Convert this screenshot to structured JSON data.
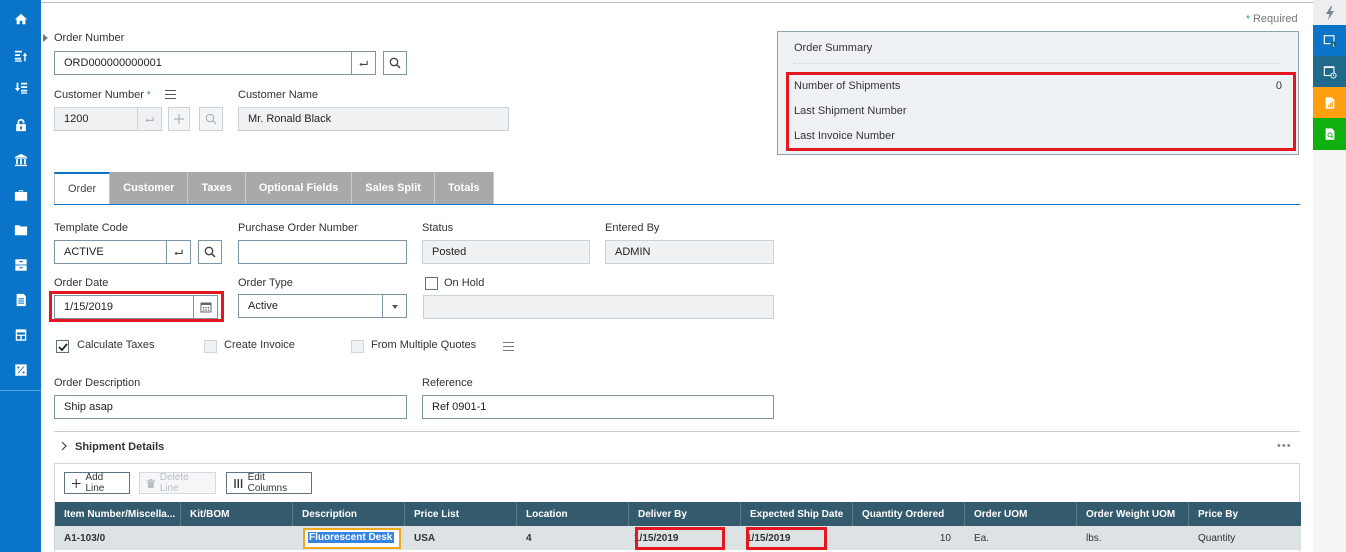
{
  "left_nav": {
    "items": [
      {
        "name": "home-icon"
      },
      {
        "name": "sort-ascending-icon"
      },
      {
        "name": "sort-descending-icon"
      },
      {
        "name": "lock-icon"
      },
      {
        "name": "bank-icon"
      },
      {
        "name": "briefcase-icon"
      },
      {
        "name": "folder-icon"
      },
      {
        "name": "cabinet-icon"
      },
      {
        "name": "document-icon"
      },
      {
        "name": "table-icon"
      },
      {
        "name": "percent-icon"
      }
    ]
  },
  "header": {
    "required_note": "Required",
    "required_mark": "*"
  },
  "order_number": {
    "label": "Order Number",
    "value": "ORD000000000001"
  },
  "customer_number": {
    "label": "Customer Number",
    "required_mark": "*",
    "value": "1200"
  },
  "customer_name": {
    "label": "Customer Name",
    "value": "Mr. Ronald Black"
  },
  "order_summary": {
    "title": "Order Summary",
    "rows": [
      {
        "label": "Number of Shipments",
        "value": "0"
      },
      {
        "label": "Last Shipment Number",
        "value": ""
      },
      {
        "label": "Last Invoice Number",
        "value": ""
      }
    ]
  },
  "tabs": [
    {
      "label": "Order",
      "active": true
    },
    {
      "label": "Customer",
      "active": false
    },
    {
      "label": "Taxes",
      "active": false
    },
    {
      "label": "Optional Fields",
      "active": false
    },
    {
      "label": "Sales Split",
      "active": false
    },
    {
      "label": "Totals",
      "active": false
    }
  ],
  "form": {
    "template_code": {
      "label": "Template Code",
      "value": "ACTIVE"
    },
    "purchase_order_number": {
      "label": "Purchase Order Number",
      "value": ""
    },
    "status": {
      "label": "Status",
      "value": "Posted"
    },
    "entered_by": {
      "label": "Entered By",
      "value": "ADMIN"
    },
    "order_date": {
      "label": "Order Date",
      "value": "1/15/2019"
    },
    "order_type": {
      "label": "Order Type",
      "value": "Active"
    },
    "on_hold": {
      "label": "On Hold",
      "checked": false,
      "value": ""
    },
    "calculate_taxes": {
      "label": "Calculate Taxes",
      "checked": true
    },
    "create_invoice": {
      "label": "Create Invoice",
      "checked": false
    },
    "from_multiple_quotes": {
      "label": "From Multiple Quotes",
      "checked": false
    },
    "order_description": {
      "label": "Order Description",
      "value": "Ship asap"
    },
    "reference": {
      "label": "Reference",
      "value": "Ref 0901-1"
    }
  },
  "shipment": {
    "title": "Shipment Details",
    "more": "•••",
    "buttons": {
      "add_line": "Add Line",
      "delete_line": "Delete Line",
      "edit_columns": "Edit Columns"
    },
    "columns": [
      "Item Number/Miscella...",
      "Kit/BOM",
      "Description",
      "Price List",
      "Location",
      "Deliver By",
      "Expected Ship Date",
      "Quantity Ordered",
      "Order UOM",
      "Order Weight UOM",
      "Price By"
    ],
    "rows": [
      {
        "item_number": "A1-103/0",
        "kit_bom": "",
        "description": "Fluorescent Desk L",
        "price_list": "USA",
        "location": "4",
        "deliver_by": "1/15/2019",
        "expected_ship_date": "1/15/2019",
        "quantity_ordered": "10",
        "order_uom": "Ea.",
        "order_weight_uom": "lbs.",
        "price_by": "Quantity"
      }
    ]
  },
  "right_bar": {
    "items": [
      {
        "name": "lightning-icon",
        "color": "#eceef0"
      },
      {
        "name": "window-badge-icon",
        "badge": "1",
        "color": "#0a74c9"
      },
      {
        "name": "window-clock-icon",
        "color": "#1f6a8c"
      },
      {
        "name": "report-icon",
        "color": "#ff9e0f"
      },
      {
        "name": "document-search-icon",
        "color": "#11b011"
      }
    ]
  },
  "colors": {
    "nav_blue": "#0a74c9",
    "highlight_red": "#e4161f",
    "grid_header": "#345b6d",
    "focus_orange": "#f0a81c"
  }
}
